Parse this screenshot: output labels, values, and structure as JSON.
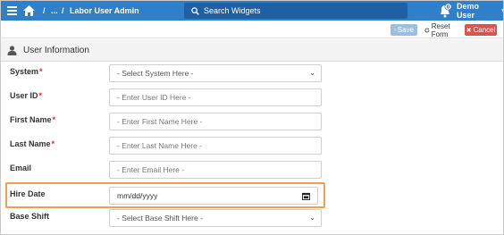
{
  "navbar": {
    "breadcrumb_sep1": "/",
    "breadcrumb_ellipsis": "...",
    "breadcrumb_sep2": "/",
    "breadcrumb_current": "Labor User Admin",
    "search_placeholder": "Search Widgets",
    "notification_count": "0",
    "user_name": "Demo User",
    "user_caret": "▾"
  },
  "toolbar": {
    "save_label": "Save",
    "reset_label": "Reset Form",
    "cancel_label": "Cancel"
  },
  "panel": {
    "title": "User Information"
  },
  "form": {
    "fields": [
      {
        "label": "System",
        "required": "*",
        "value": "- Select System Here -",
        "kind": "select"
      },
      {
        "label": "User ID",
        "required": "*",
        "value": "- Enter User ID Here -",
        "kind": "text"
      },
      {
        "label": "First Name",
        "required": "*",
        "value": "- Enter First Name Here -",
        "kind": "text"
      },
      {
        "label": "Last Name",
        "required": "*",
        "value": "- Enter Last Name Here -",
        "kind": "text"
      },
      {
        "label": "Email",
        "required": "",
        "value": "- Enter Email Here -",
        "kind": "text"
      },
      {
        "label": "Hire Date",
        "required": "",
        "value": "mm/dd/yyyy",
        "kind": "date"
      },
      {
        "label": "Base Shift",
        "required": "",
        "value": "- Select Base Shift Here -",
        "kind": "select"
      }
    ]
  },
  "colors": {
    "navbar": "#2f7fc9",
    "highlight": "#f0a04b",
    "required": "#c9302c",
    "cancel": "#d9534f"
  }
}
